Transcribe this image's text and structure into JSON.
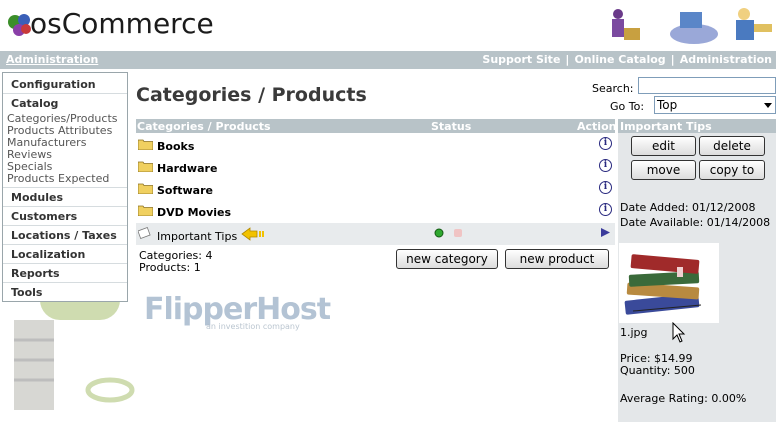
{
  "header": {
    "logo_text": "osCommerce"
  },
  "topbar": {
    "admin_link": "Administration",
    "links": [
      "Support Site",
      "Online Catalog",
      "Administration"
    ]
  },
  "nav": {
    "configuration": "Configuration",
    "catalog": "Catalog",
    "catalog_items": [
      "Categories/Products",
      "Products Attributes",
      "Manufacturers",
      "Reviews",
      "Specials",
      "Products Expected"
    ],
    "modules": "Modules",
    "customers": "Customers",
    "locations": "Locations / Taxes",
    "localization": "Localization",
    "reports": "Reports",
    "tools": "Tools"
  },
  "watermark": {
    "brand": "FlipperHost",
    "tagline": "an investition company"
  },
  "page": {
    "title": "Categories / Products",
    "search_label": "Search:",
    "search_value": "",
    "goto_label": "Go To:",
    "goto_value": "Top"
  },
  "list": {
    "headers": {
      "name": "Categories / Products",
      "status": "Status",
      "action": "Action"
    },
    "categories": [
      "Books",
      "Hardware",
      "Software",
      "DVD Movies"
    ],
    "product": "Important Tips",
    "categories_count": "Categories: 4",
    "products_count": "Products: 1",
    "new_category": "new category",
    "new_product": "new product"
  },
  "panel": {
    "title": "Important Tips",
    "edit": "edit",
    "delete": "delete",
    "move": "move",
    "copy_to": "copy to",
    "date_added": "Date Added: 01/12/2008",
    "date_available": "Date Available: 01/14/2008",
    "image_name": "1.jpg",
    "price": "Price: $14.99",
    "quantity": "Quantity: 500",
    "rating": "Average Rating: 0.00%"
  },
  "colors": {
    "bar": "#b8c3c8",
    "panel": "#e4e7e9",
    "status_active": "#2fa82f",
    "status_inactive": "#f0c4c4",
    "arrow": "#f2c200"
  }
}
